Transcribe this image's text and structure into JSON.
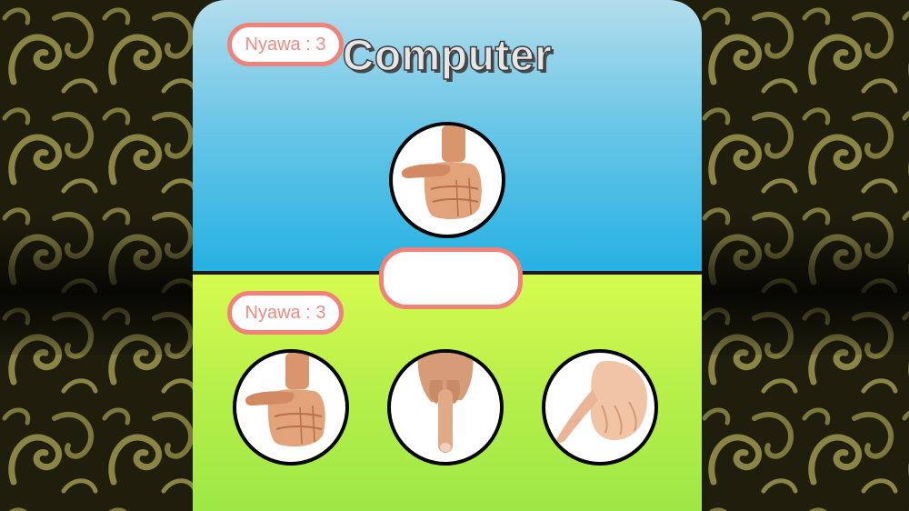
{
  "game": {
    "title": "Computer",
    "computer": {
      "lives_label": "Nyawa : 3",
      "current_hand_icon": "thumb-fist-icon"
    },
    "player": {
      "lives_label": "Nyawa : 3",
      "choices": [
        {
          "id": "thumb",
          "icon": "thumb-fist-icon"
        },
        {
          "id": "index",
          "icon": "index-finger-down-icon"
        },
        {
          "id": "pinky",
          "icon": "pinky-finger-icon"
        }
      ]
    },
    "result_text": ""
  },
  "colors": {
    "sky_top": "#b2dded",
    "sky_bottom": "#24b1e3",
    "grass_top": "#d6fb4f",
    "grass_bottom": "#9de746",
    "pill_border": "#f2817a",
    "pill_text": "#f08a83"
  }
}
